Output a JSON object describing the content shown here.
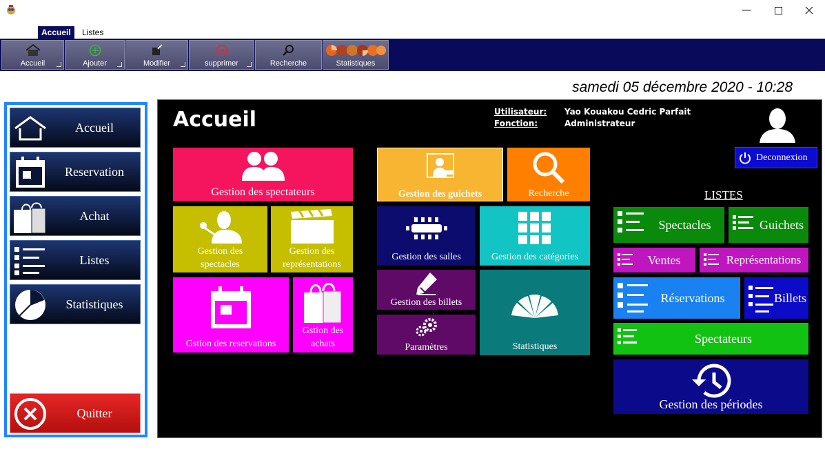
{
  "tabs": [
    "Accueil",
    "Listes"
  ],
  "ribbon": {
    "buttons": [
      {
        "label": "Accueil",
        "icon": "home-icon"
      },
      {
        "label": "Ajouter",
        "icon": "add-circle-icon"
      },
      {
        "label": "Modifier",
        "icon": "edit-icon"
      },
      {
        "label": "supprimer",
        "icon": "remove-circle-icon"
      },
      {
        "label": "Recherche",
        "icon": "search-icon"
      },
      {
        "label": "Statistiques",
        "icon": "pie-chart-icon"
      }
    ]
  },
  "datetime": "samedi 05 décembre 2020 - 10:28",
  "sidebar": {
    "items": [
      {
        "label": "Accueil",
        "icon": "home-icon"
      },
      {
        "label": "Reservation",
        "icon": "calendar-icon"
      },
      {
        "label": "Achat",
        "icon": "shopping-bag-icon"
      },
      {
        "label": "Listes",
        "icon": "list-icon"
      },
      {
        "label": "Statistiques",
        "icon": "pie-chart-icon"
      }
    ],
    "quit_label": "Quitter"
  },
  "main": {
    "title": "Accueil",
    "user_label": "Utilisateur:",
    "user_value": "Yao Kouakou Cedric Parfait",
    "role_label": "Fonction:",
    "role_value": "Administrateur",
    "logout_label": "Deconnexion"
  },
  "tiles": {
    "spectateurs": "Gestion des spectateurs",
    "spectacles_1": "Gestion des",
    "spectacles_2": "spectacles",
    "representations_1": "Gestion des",
    "representations_2": "représentations",
    "reservations": "Gstion des reservations",
    "achats_1": "Gstion des",
    "achats_2": "achats",
    "guichets": "Gestion des guichets",
    "recherche": "Recherche",
    "salles": "Gestion des salles",
    "categories": "Gestion des catégories",
    "billets": "Gestion des billets",
    "parametres": "Paramètres",
    "statistiques": "Statistiques"
  },
  "listes": {
    "title": "LISTES",
    "spectacles": "Spectacles",
    "guichets": "Guichets",
    "ventes": "Ventes",
    "representations": "Représentations",
    "reservations": "Réservations",
    "billets": "Billets",
    "spectateurs": "Spectateurs",
    "periodes": "Gestion des périodes"
  },
  "colors": {
    "ribbon": "#0a0a5a",
    "sidebar_border": "#1e88ff",
    "pink": "#f5155f",
    "olive": "#c6bf00",
    "magenta": "#ff00ff",
    "gold": "#f8b531",
    "orange": "#ff8000",
    "navy": "#0c0c6e",
    "teal": "#12c4c4",
    "purple": "#5f0a66",
    "dark_teal": "#0a7a7a",
    "green": "#0a8a0a",
    "violet": "#c016c0",
    "blue": "#1a82f0",
    "royal": "#0b0bc8",
    "bright_green": "#12c212",
    "dark_blue": "#0a0a8a"
  }
}
